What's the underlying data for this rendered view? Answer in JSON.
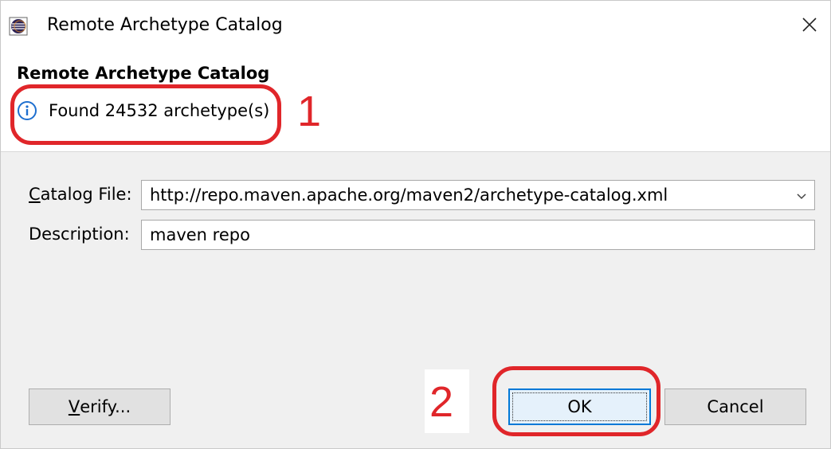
{
  "window": {
    "title": "Remote Archetype Catalog",
    "close_symbol": "✕"
  },
  "header": {
    "title": "Remote Archetype Catalog",
    "info_message": "Found 24532 archetype(s)"
  },
  "form": {
    "catalog_file": {
      "label_prefix": "C",
      "label_rest": "atalog File:",
      "value": "http://repo.maven.apache.org/maven2/archetype-catalog.xml"
    },
    "description": {
      "label": "Description:",
      "value": "maven repo"
    }
  },
  "buttons": {
    "verify_prefix": "V",
    "verify_rest": "erify...",
    "ok": "OK",
    "cancel": "Cancel"
  },
  "annotations": {
    "one": "1",
    "two": "2"
  },
  "colors": {
    "annotation_red": "#e0262a",
    "ok_border": "#0078d7",
    "info_blue": "#1e6fcf"
  },
  "icons": [
    "eclipse-app-icon",
    "close-icon",
    "info-icon",
    "chevron-down-icon"
  ]
}
